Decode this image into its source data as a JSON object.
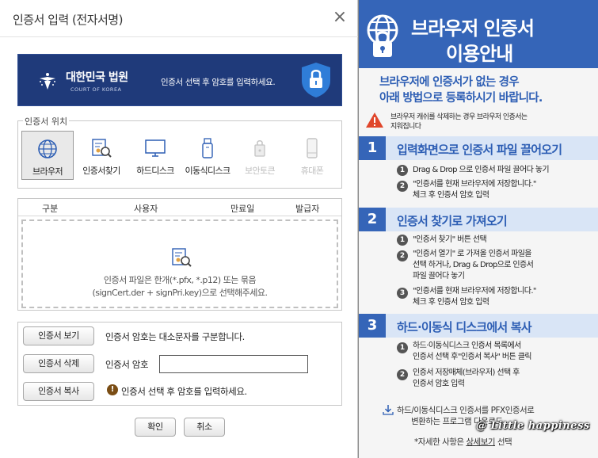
{
  "dialog": {
    "title": "인증서 입력 (전자서명)",
    "close_glyph": "×",
    "banner": {
      "org_name": "대한민국 법원",
      "org_name_en": "COURT OF KOREA",
      "message": "인증서 선택 후 암호를 입력하세요.",
      "colors": {
        "background": "#1f3a7a",
        "lock": "#2f7dd8"
      }
    },
    "location": {
      "legend": "인증서 위치",
      "items": [
        {
          "label": "브라우저",
          "icon": "globe-icon",
          "selected": true,
          "enabled": true
        },
        {
          "label": "인증서찾기",
          "icon": "certificate-search-icon",
          "selected": false,
          "enabled": true
        },
        {
          "label": "하드디스크",
          "icon": "monitor-icon",
          "selected": false,
          "enabled": true
        },
        {
          "label": "이동식디스크",
          "icon": "usb-icon",
          "selected": false,
          "enabled": true
        },
        {
          "label": "보안토큰",
          "icon": "security-token-icon",
          "selected": false,
          "enabled": false
        },
        {
          "label": "휴대폰",
          "icon": "phone-icon",
          "selected": false,
          "enabled": false
        }
      ]
    },
    "table": {
      "columns": [
        "구분",
        "사용자",
        "만료일",
        "발급자"
      ],
      "empty_line1": "인증서 파일은 한개(*.pfx, *.p12) 또는 묶음",
      "empty_line2": "(signCert.der + signPri.key)으로 선택해주세요."
    },
    "actions": {
      "view_button": "인증서 보기",
      "delete_button": "인증서 삭제",
      "copy_button": "인증서 복사",
      "case_note": "인증서 암호는 대소문자를 구분합니다.",
      "password_label": "인증서 암호",
      "password_value": "",
      "warning": "인증서 선택 후 암호를 입력하세요."
    },
    "confirm_button": "확인",
    "cancel_button": "취소"
  },
  "guide": {
    "title_line1": "브라우저 인증서",
    "title_line2": "이용안내",
    "subtitle_line1": "브라우저에 인증서가 없는 경우",
    "subtitle_line2": "아래 방법으로 등록하시기 바랍니다.",
    "warning_line1": "브라우저 캐쉬를 삭제하는 경우 브라우저 인증서는",
    "warning_line2": "지워집니다",
    "steps": [
      {
        "number": "1",
        "title": "입력화면으로 인증서 파일 끌어오기",
        "items": [
          {
            "number": "1",
            "lines": [
              "Drag & Drop 으로 인증서 파일 끌어다 놓기"
            ]
          },
          {
            "number": "2",
            "lines": [
              "\"인증서를 현재 브라우저에 저장합니다.\"",
              "체크 후 인증서 암호 입력"
            ]
          }
        ]
      },
      {
        "number": "2",
        "title": "인증서 찾기로 가져오기",
        "items": [
          {
            "number": "1",
            "lines": [
              "\"인증서 찾기\" 버튼 선택"
            ]
          },
          {
            "number": "2",
            "lines": [
              "\"인증서 열기\" 로 가져올 인증서 파일을",
              "선택 하거나, Drag & Drop으로 인증서",
              "파일 끌어다 놓기"
            ]
          },
          {
            "number": "3",
            "lines": [
              "\"인증서를 현재 브라우저에 저장합니다.\"",
              "체크 후 인증서 암호 입력"
            ]
          }
        ]
      },
      {
        "number": "3",
        "title": "하드·이동식 디스크에서 복사",
        "items": [
          {
            "number": "1",
            "lines": [
              "하드·이동식디스크 인증서 목록에서",
              "인증서 선택 후\"인증서 복사\" 버튼 클릭"
            ]
          },
          {
            "number": "2",
            "lines": [
              "인증서 저장매체(브라우저) 선택 후",
              "인증서 암호 입력"
            ]
          }
        ]
      }
    ],
    "download_line1": "하드/이동식디스크 인증서를 PFX인증서로",
    "download_line2": "변환하는 프로그램 다운로드",
    "detail_prefix": "*자세한 사항은 ",
    "detail_link": "상세보기",
    "detail_suffix": " 선택",
    "watermark": "@ Little happiness",
    "colors": {
      "accent": "#3565b8",
      "step_bar": "#d9e5f6",
      "text_accent": "#2d5eb4"
    }
  }
}
